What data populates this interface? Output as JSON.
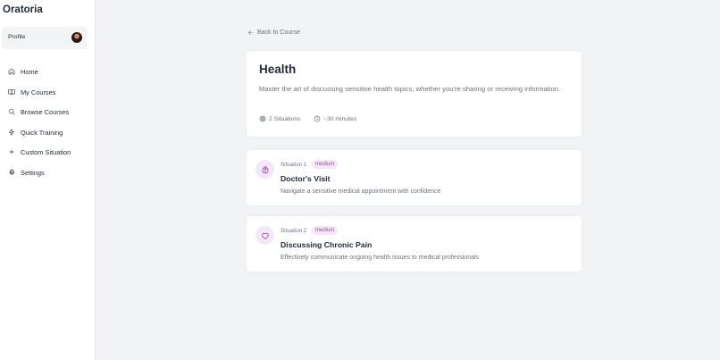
{
  "app": {
    "name": "Oratoria"
  },
  "sidebar": {
    "profile_label": "Profile",
    "items": [
      {
        "label": "Home",
        "icon": "home-icon"
      },
      {
        "label": "My Courses",
        "icon": "book-open-icon"
      },
      {
        "label": "Browse Courses",
        "icon": "search-icon"
      },
      {
        "label": "Quick Training",
        "icon": "lightning-icon"
      },
      {
        "label": "Custom Situation",
        "icon": "plus-icon"
      },
      {
        "label": "Settings",
        "icon": "gear-icon"
      }
    ]
  },
  "back_link": "Back to Course",
  "course": {
    "title": "Health",
    "description": "Master the art of discussing sensitive health topics, whether you're sharing or receiving information.",
    "situations_count": "2 Situations",
    "duration": "~30 minutes"
  },
  "situations": [
    {
      "number": "Situation 1",
      "difficulty": "medium",
      "title": "Doctor's Visit",
      "description": "Navigate a sensitive medical appointment with confidence",
      "icon": "brain-icon"
    },
    {
      "number": "Situation 2",
      "difficulty": "medium",
      "title": "Discussing Chronic Pain",
      "description": "Effectively communicate ongoing health issues to medical professionals",
      "icon": "heart-icon"
    }
  ],
  "colors": {
    "accent": "#a24fb0",
    "badge_bg": "#f3e6f5",
    "icon_bg": "#f3e8f6",
    "background": "#f1f3f5"
  }
}
